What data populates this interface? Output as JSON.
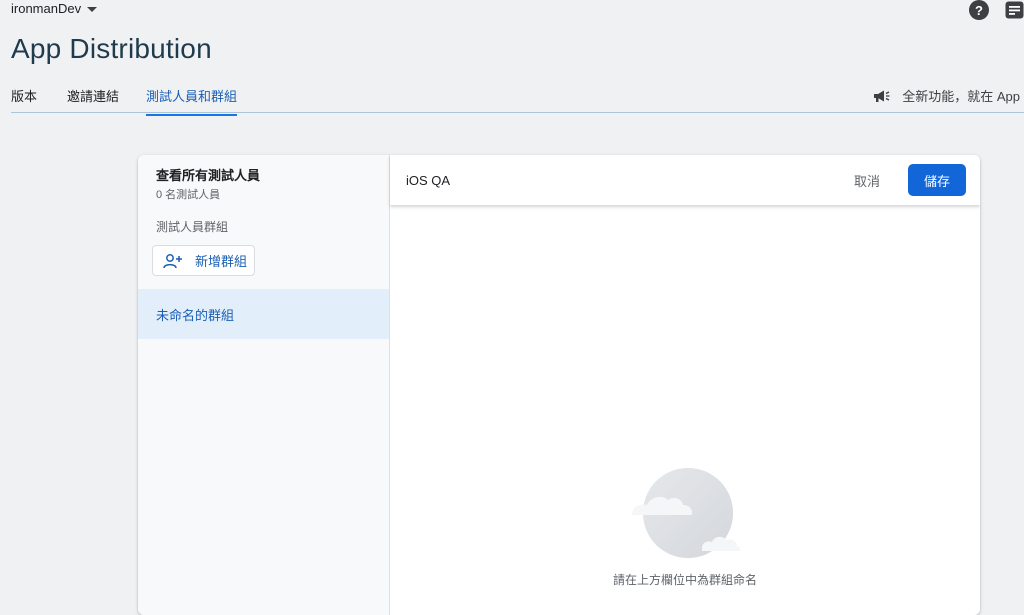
{
  "header": {
    "project_name": "ironmanDev",
    "help_icon": "help-circle-icon",
    "feedback_icon": "feedback-icon"
  },
  "page": {
    "title": "App Distribution"
  },
  "tabs": [
    {
      "label": "版本",
      "active": false
    },
    {
      "label": "邀請連結",
      "active": false
    },
    {
      "label": "測試人員和群組",
      "active": true
    }
  ],
  "announcement": {
    "icon": "megaphone-icon",
    "text": "全新功能，就在 App"
  },
  "sidebar": {
    "view_all_title": "查看所有測試人員",
    "view_all_count": "0 名測試人員",
    "groups_label": "測試人員群組",
    "add_group_label": "新增群組",
    "add_group_icon": "person-add-icon",
    "groups": [
      {
        "label": "未命名的群組",
        "selected": true
      }
    ]
  },
  "editor": {
    "group_name_value": "iOS QA",
    "cancel_label": "取消",
    "save_label": "儲存",
    "empty_icon": "cloud-illustration-icon",
    "empty_message": "請在上方欄位中為群組命名"
  },
  "colors": {
    "accent": "#1a73e8",
    "save_button": "#1266d8",
    "selected_row": "#e3eefb",
    "page_background": "#f0f1f3"
  }
}
